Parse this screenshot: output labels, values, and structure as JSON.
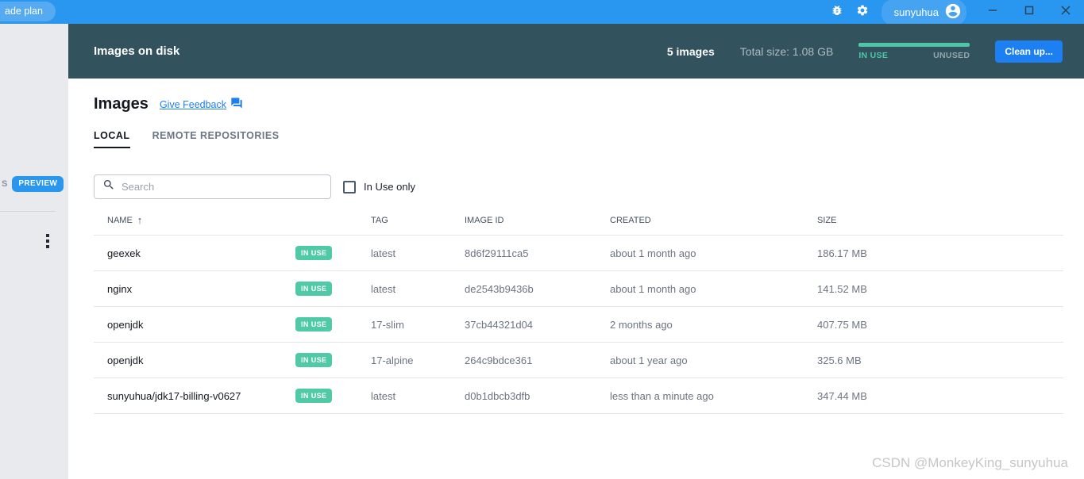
{
  "titlebar": {
    "upgrade_pill_label": "ade plan",
    "user_name": "sunyuhua",
    "icons": {
      "bug": "bug-icon",
      "gear": "gear-icon",
      "person": "person-circle-icon",
      "minimize": "minimize-icon",
      "maximize": "maximize-icon",
      "close": "close-icon"
    }
  },
  "sidebar": {
    "truncated_label": "S",
    "preview_badge": "PREVIEW",
    "kebab_menu": "more-options"
  },
  "header": {
    "title": "Images on disk",
    "image_count": "5 images",
    "total_size": "Total size: 1.08 GB",
    "in_use_label": "IN USE",
    "unused_label": "UNUSED",
    "cleanup_button": "Clean up..."
  },
  "main": {
    "title": "Images",
    "feedback_link": "Give Feedback",
    "tabs": [
      {
        "label": "LOCAL",
        "active": true
      },
      {
        "label": "REMOTE REPOSITORIES",
        "active": false
      }
    ],
    "search_placeholder": "Search",
    "in_use_only_label": "In Use only",
    "table": {
      "headers": [
        "NAME",
        "TAG",
        "IMAGE ID",
        "CREATED",
        "SIZE"
      ],
      "sort_arrow": "↑",
      "rows": [
        {
          "name": "geexek",
          "badge": "IN USE",
          "tag": "latest",
          "image_id": "8d6f29111ca5",
          "created": "about 1 month ago",
          "size": "186.17 MB"
        },
        {
          "name": "nginx",
          "badge": "IN USE",
          "tag": "latest",
          "image_id": "de2543b9436b",
          "created": "about 1 month ago",
          "size": "141.52 MB"
        },
        {
          "name": "openjdk",
          "badge": "IN USE",
          "tag": "17-slim",
          "image_id": "37cb44321d04",
          "created": "2 months ago",
          "size": "407.75 MB"
        },
        {
          "name": "openjdk",
          "badge": "IN USE",
          "tag": "17-alpine",
          "image_id": "264c9bdce361",
          "created": "about 1 year ago",
          "size": "325.6 MB"
        },
        {
          "name": "sunyuhua/jdk17-billing-v0627",
          "badge": "IN USE",
          "tag": "latest",
          "image_id": "d0b1dbcb3dfb",
          "created": "less than a minute ago",
          "size": "347.44 MB"
        }
      ]
    }
  },
  "watermark": "CSDN @MonkeyKing_sunyuhua",
  "colors": {
    "titlebar_blue": "#2997f0",
    "header_teal": "#32525d",
    "badge_teal": "#4fc9a6",
    "accent_blue": "#1c80f2",
    "sidebar_gray": "#e8eaed"
  }
}
